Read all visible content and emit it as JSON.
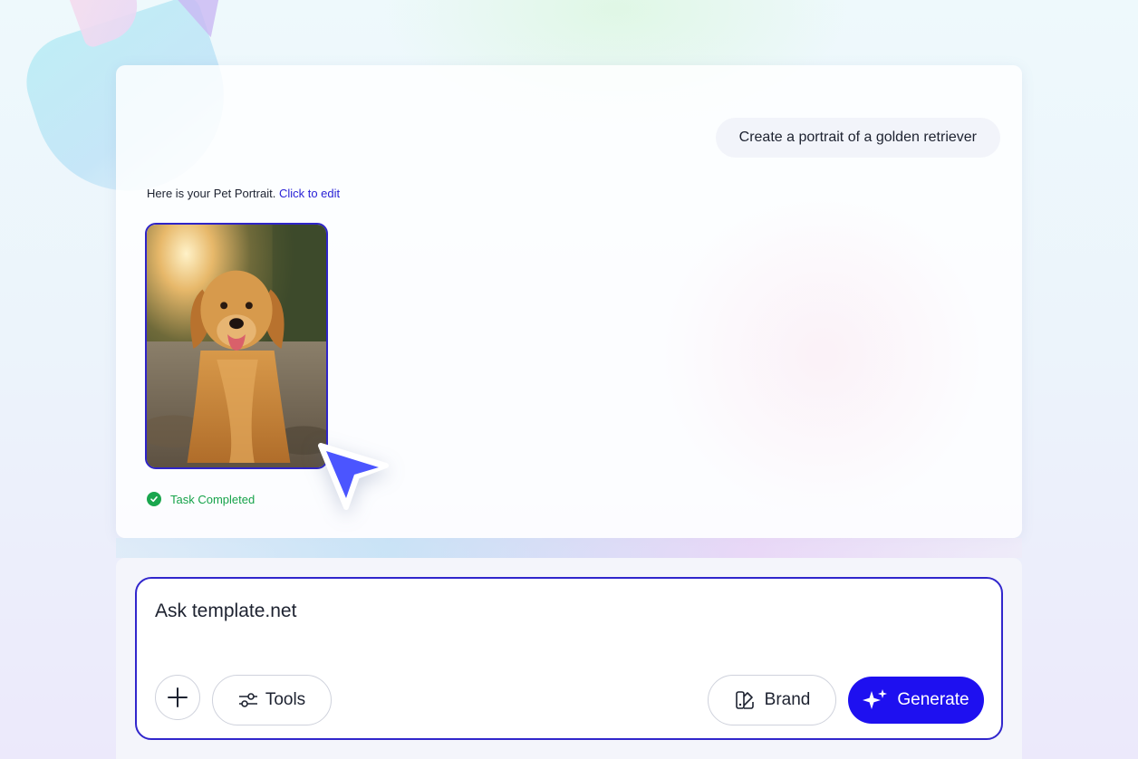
{
  "chat": {
    "user_message": "Create a portrait of a golden retriever",
    "assistant_text": "Here is your Pet Portrait.",
    "assistant_link": "Click to edit",
    "status": "Task Completed"
  },
  "composer": {
    "placeholder": "Ask template.net",
    "tools_label": "Tools",
    "brand_label": "Brand",
    "generate_label": "Generate"
  },
  "colors": {
    "accent": "#1e10f0",
    "border_accent": "#3126cc",
    "link": "#2a22d6",
    "success": "#16a34a"
  },
  "icons": {
    "plus": "plus-icon",
    "tools": "sliders-icon",
    "brand": "brand-palette-icon",
    "generate": "sparkle-icon",
    "status": "check-circle-icon",
    "cursor": "cursor-arrow-icon"
  }
}
